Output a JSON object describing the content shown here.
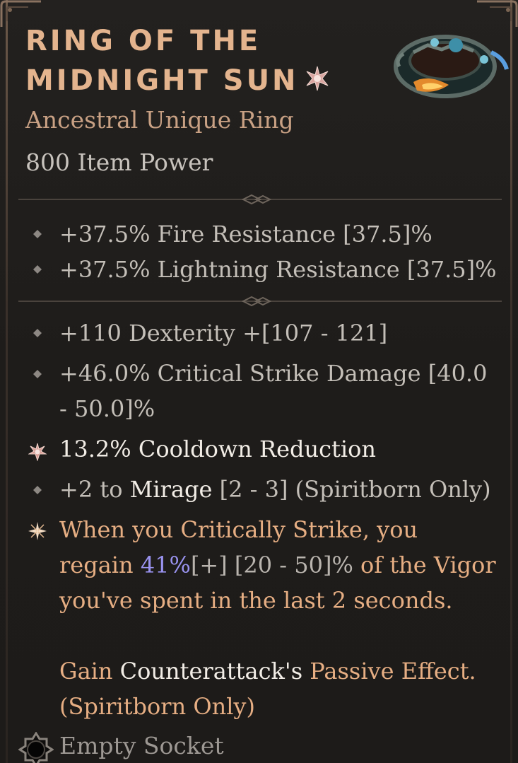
{
  "item": {
    "name_line1": "RING OF THE",
    "name_line2": "MIDNIGHT SUN",
    "unique_icon": "unique-star-icon",
    "subtitle": "Ancestral Unique Ring",
    "item_power": "800 Item Power",
    "art_icon": "ring-item-icon"
  },
  "implicits": [
    {
      "text": "+37.5% Fire Resistance [37.5]%"
    },
    {
      "text": "+37.5% Lightning Resistance [37.5]%"
    }
  ],
  "affixes": [
    {
      "text": "+110 Dexterity +[107 - 121]"
    },
    {
      "line1": "+46.0% Critical Strike Damage [40.0",
      "line2": "- 50.0]%"
    },
    {
      "text": "13.2% Cooldown Reduction"
    },
    {
      "prefix": "+2 to ",
      "skill": "Mirage",
      "suffix": " [2 - 3] (Spiritborn Only)"
    }
  ],
  "unique_power": {
    "line1": "When you Critically Strike, you",
    "line2_a": "regain ",
    "line2_value": "41%",
    "line2_b": "[+] [20 - 50]%",
    "line2_c": " of the Vigor",
    "line3": "you've spent in the last 2 seconds.",
    "line4_a": "Gain ",
    "line4_skill": "Counterattack's",
    "line4_b": " Passive Effect.",
    "line5": "(Spiritborn Only)"
  },
  "socket": {
    "label": "Empty Socket",
    "icon": "empty-socket-icon"
  },
  "colors": {
    "title": "#e4b48e",
    "unique_text": "#e6ae83",
    "stat_text": "#c4bfb8",
    "greater_value": "#9a93f0"
  }
}
